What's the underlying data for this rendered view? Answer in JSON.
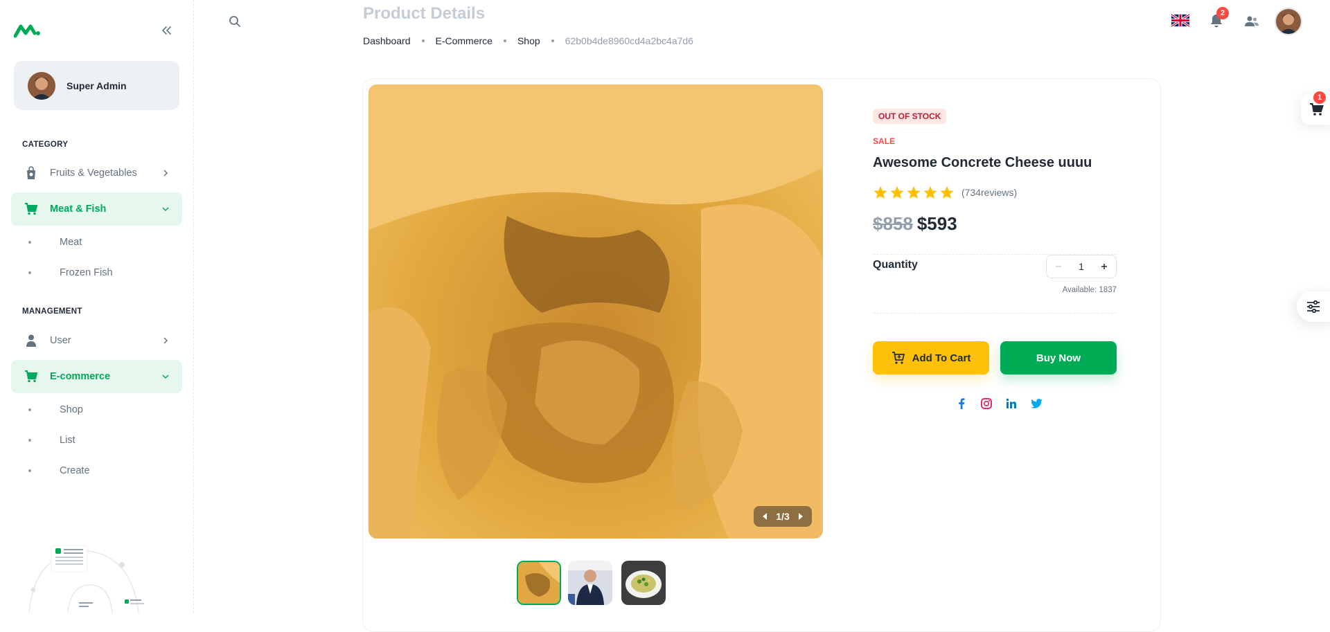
{
  "colors": {
    "primary": "#00ab55",
    "warning": "#ffc107",
    "error": "#ff4842",
    "muted": "#637381"
  },
  "sidebar": {
    "account_name": "Super Admin",
    "sections": [
      {
        "title": "CATEGORY"
      },
      {
        "title": "MANAGEMENT"
      }
    ],
    "items": [
      {
        "label": "Fruits & Vegetables",
        "icon": "shopping-bag-icon",
        "expanded": false
      },
      {
        "label": "Meat & Fish",
        "icon": "cart-icon",
        "expanded": true,
        "children": [
          "Meat",
          "Frozen Fish"
        ]
      },
      {
        "label": "User",
        "icon": "user-icon",
        "expanded": false
      },
      {
        "label": "E-commerce",
        "icon": "cart-icon",
        "expanded": true,
        "children": [
          "Shop",
          "List",
          "Create"
        ]
      }
    ]
  },
  "header": {
    "title": "Product Details",
    "breadcrumb": [
      "Dashboard",
      "E-Commerce",
      "Shop",
      "62b0b4de8960cd4a2bc4a7d6"
    ],
    "notification_count": "2",
    "language_icon": "uk-flag-icon"
  },
  "product": {
    "stock_status": "OUT OF STOCK",
    "sale_label": "SALE",
    "name": "Awesome Concrete Cheese uuuu",
    "rating": 5,
    "reviews": "(734reviews)",
    "old_price": "$858",
    "price": "$593",
    "quantity_label": "Quantity",
    "quantity": "1",
    "available": "Available: 1837",
    "add_to_cart": "Add To Cart",
    "buy_now": "Buy Now",
    "image_counter": "1/3",
    "social": [
      "facebook-icon",
      "instagram-icon",
      "linkedin-icon",
      "twitter-icon"
    ]
  },
  "cart": {
    "count": "1"
  }
}
